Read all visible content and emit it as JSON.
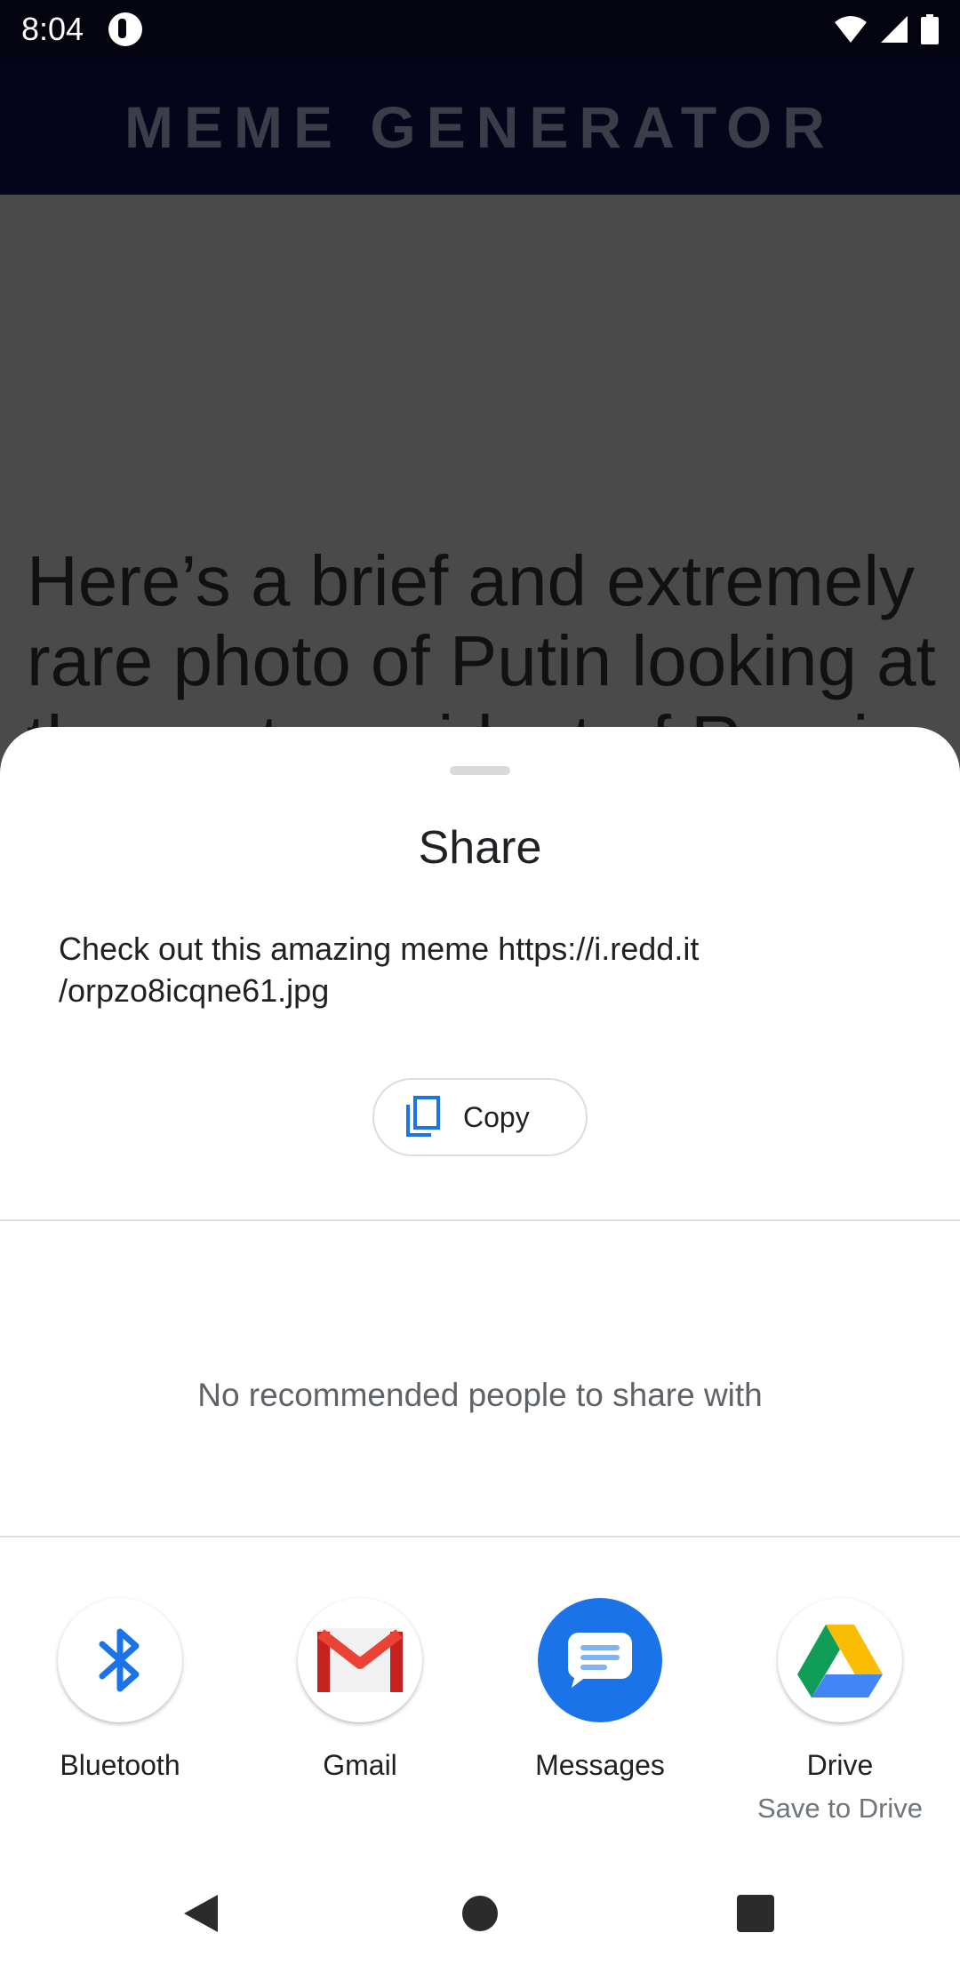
{
  "status_bar": {
    "time": "8:04"
  },
  "app_bar": {
    "title": "MEME GENERATOR"
  },
  "background": {
    "caption": "Here’s a brief and extremely rare photo of Putin looking at the next president of Russia"
  },
  "share_sheet": {
    "title": "Share",
    "text": "Check out this amazing meme https://i.redd.it/orpzo8icqne61.jpg",
    "text_line1": "Check out this amazing meme https://i.redd.it",
    "text_line2": "/orpzo8icqne61.jpg",
    "copy_label": "Copy",
    "no_people_message": "No recommended people to share with",
    "targets": [
      {
        "label": "Bluetooth",
        "icon": "bluetooth-icon"
      },
      {
        "label": "Gmail",
        "icon": "gmail-icon"
      },
      {
        "label": "Messages",
        "icon": "messages-icon"
      },
      {
        "label": "Drive",
        "sublabel": "Save to Drive",
        "icon": "drive-icon"
      }
    ]
  },
  "nav_bar": {
    "icons": [
      "back-icon",
      "home-icon",
      "recents-icon"
    ]
  },
  "colors": {
    "status_bar_bg": "#03040f",
    "app_bar_bg": "#04051a",
    "scrim": "#4a4a4a",
    "accent_blue": "#1a73e8",
    "sheet_bg": "#ffffff"
  }
}
